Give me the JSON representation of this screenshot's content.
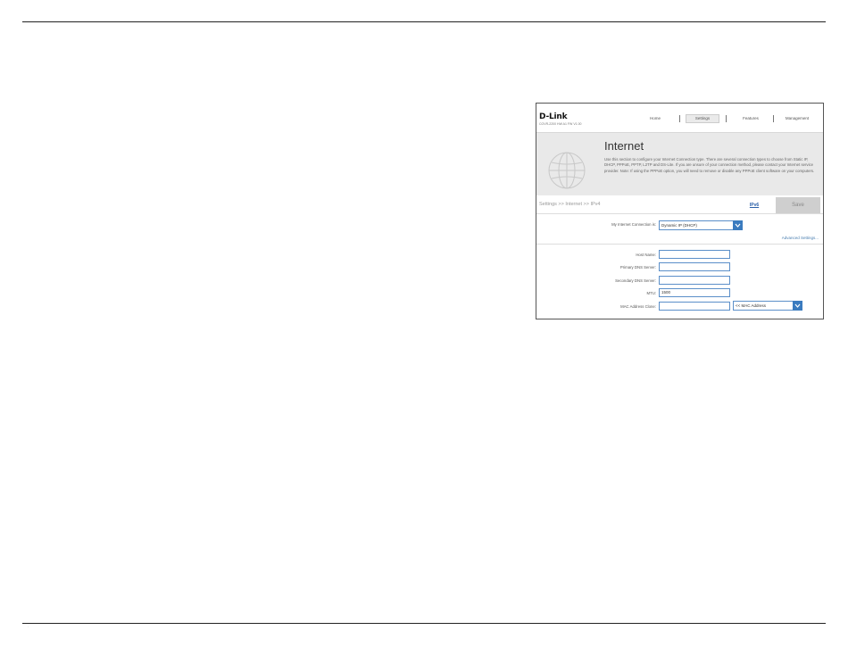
{
  "document": {
    "page_marker": "'"
  },
  "header": {
    "logo": "D-Link",
    "model": "COVR-2200 HW A1 FW V1.00",
    "nav": {
      "home": "Home",
      "settings": "Settings",
      "features": "Features",
      "management": "Management"
    }
  },
  "hero": {
    "title": "Internet",
    "description": "Use this section to configure your Internet Connection type. There are several connection types to choose from Static IP, DHCP, PPPoE, PPTP, L2TP and DS-Lite. If you are unsure of your connection method, please contact your Internet service provider. Note: If using the PPPoE option, you will need to remove or disable any PPPoE client software on your computers."
  },
  "toolbar": {
    "breadcrumb": "Settings >> Internet >> IPv4",
    "ipv6_label": "IPv6",
    "save_label": "Save"
  },
  "form": {
    "connection_label": "My Internet Connection is:",
    "connection_value": "Dynamic IP (DHCP)",
    "advanced_link": "Advanced Settings...",
    "host_name_label": "Host Name:",
    "host_name_value": "",
    "primary_dns_label": "Primary DNS Server:",
    "primary_dns_value": "",
    "secondary_dns_label": "Secondary DNS Server:",
    "secondary_dns_value": "",
    "mtu_label": "MTU:",
    "mtu_value": "1500",
    "mac_clone_label": "MAC Address Clone:",
    "mac_clone_value": "",
    "mac_select_value": "<< MAC Address"
  },
  "colors": {
    "accent": "#3a7bbf",
    "hero_bg": "#e9e9e9",
    "save_bg": "#cfcfcf"
  }
}
